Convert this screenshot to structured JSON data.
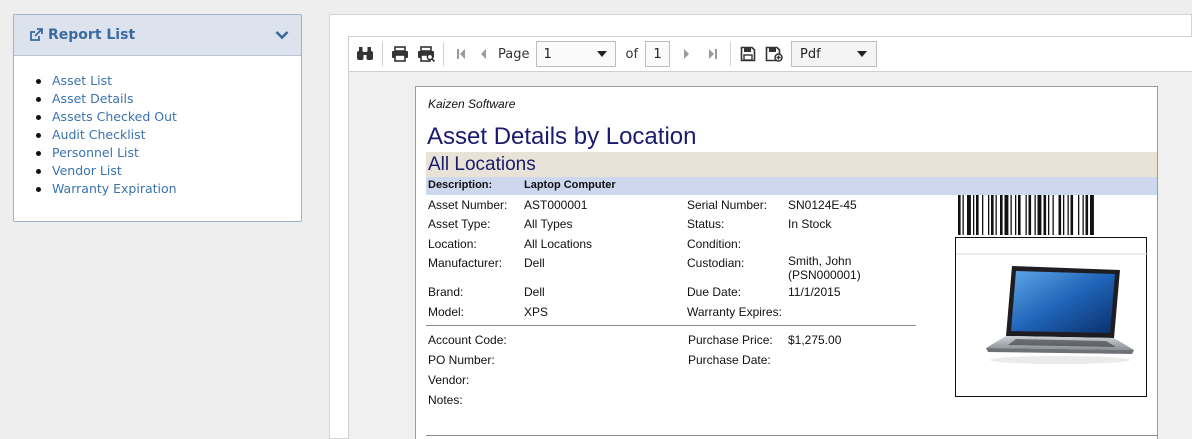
{
  "sidebar": {
    "title": "Report List",
    "links": [
      "Asset List",
      "Asset Details",
      "Assets Checked Out",
      "Audit Checklist",
      "Personnel List",
      "Vendor List",
      "Warranty Expiration"
    ]
  },
  "toolbar": {
    "page_label": "Page",
    "current_page": "1",
    "of_label": "of",
    "total_pages": "1",
    "export_format": "Pdf",
    "icons": [
      "binoculars-icon",
      "print-icon",
      "print-preview-icon",
      "first-page-icon",
      "prev-page-icon",
      "next-page-icon",
      "last-page-icon",
      "save-icon",
      "save-as-icon"
    ]
  },
  "report": {
    "company": "Kaizen Software",
    "title": "Asset Details by Location",
    "location_group": "All Locations",
    "description_label": "Description:",
    "description_value": "Laptop Computer",
    "left_fields": [
      {
        "label": "Asset Number:",
        "value": "AST000001"
      },
      {
        "label": "Asset Type:",
        "value": "All Types"
      },
      {
        "label": "Location:",
        "value": "All Locations"
      },
      {
        "label": "Manufacturer:",
        "value": "Dell"
      },
      {
        "label": "Brand:",
        "value": "Dell"
      },
      {
        "label": "Model:",
        "value": "XPS"
      }
    ],
    "right_fields": [
      {
        "label": "Serial Number:",
        "value": "SN0124E-45"
      },
      {
        "label": "Status:",
        "value": "In Stock"
      },
      {
        "label": "Condition:",
        "value": ""
      },
      {
        "label": "Custodian:",
        "value": "Smith, John",
        "value2": "(PSN000001)"
      },
      {
        "label": "Due Date:",
        "value": "11/1/2015"
      },
      {
        "label": "Warranty Expires:",
        "value": ""
      }
    ],
    "left_fields2": [
      {
        "label": "Account Code:",
        "value": ""
      },
      {
        "label": "PO Number:",
        "value": ""
      },
      {
        "label": "Vendor:",
        "value": ""
      },
      {
        "label": "Notes:",
        "value": ""
      }
    ],
    "right_fields2": [
      {
        "label": "Purchase Price:",
        "value": "$1,275.00"
      },
      {
        "label": "Purchase Date:",
        "value": ""
      }
    ]
  },
  "colors": {
    "link": "#3a73ae",
    "panel_header": "#dce3ec",
    "report_title": "#1a1a6e",
    "location_band": "#e9e3d7",
    "description_band": "#cdd8ee"
  }
}
